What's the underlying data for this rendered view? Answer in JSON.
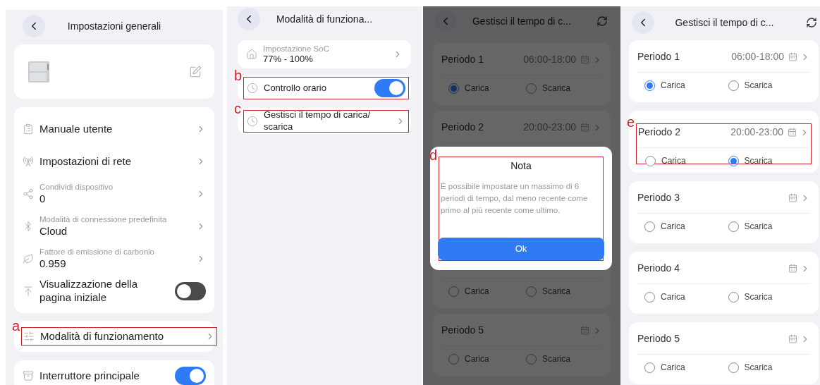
{
  "general_settings": {
    "title": "Impostazioni generali",
    "items": [
      {
        "kind": "link",
        "label": "Manuale utente"
      },
      {
        "kind": "link",
        "label": "Impostazioni di rete"
      },
      {
        "kind": "value",
        "caption": "Condividi dispositivo",
        "value": "0"
      },
      {
        "kind": "value",
        "caption": "Modalità di connessione predefinita",
        "value": "Cloud"
      },
      {
        "kind": "value",
        "caption": "Fattore di emissione di carbonio",
        "value": "0.959"
      },
      {
        "kind": "toggle",
        "label": "Visualizzazione della pagina iniziale",
        "on": false
      }
    ],
    "mode_row": {
      "label": "Modalità di funzionamento",
      "annotation": "a"
    },
    "main_switch": {
      "label": "Interruttore principale",
      "on": true
    }
  },
  "operating_mode": {
    "title": "Modalità di funziona...",
    "items": [
      {
        "kind": "value",
        "caption": "Impostazione SoC",
        "value": "77% - 100%"
      },
      {
        "kind": "toggle",
        "label": "Controllo orario",
        "on": true,
        "annotation": "b"
      },
      {
        "kind": "link",
        "label": "Gestisci il tempo di carica/ scarica",
        "annotation": "c"
      }
    ]
  },
  "schedule_with_note": {
    "title": "Gestisci il tempo di c...",
    "periods": [
      {
        "title": "Periodo 1",
        "time": "06:00-18:00",
        "options": [
          {
            "label": "Carica",
            "selected": true
          },
          {
            "label": "Scarica",
            "selected": false
          }
        ]
      },
      {
        "title": "Periodo 2",
        "time": "20:00-23:00"
      },
      {
        "options": [
          {
            "label": "Carica",
            "selected": false
          },
          {
            "label": "Scarica",
            "selected": false
          }
        ]
      },
      {
        "title": "Periodo 5",
        "options": [
          {
            "label": "Carica",
            "selected": false
          },
          {
            "label": "Scarica",
            "selected": false
          }
        ]
      }
    ],
    "dialog": {
      "title": "Nota",
      "message": "È possibile impostare un massimo di 6 periodi di tempo, dal meno recente come primo al più recente come ultimo.",
      "button": "Ok",
      "annotation": "d"
    }
  },
  "schedule": {
    "title": "Gestisci il tempo di c...",
    "periods": [
      {
        "title": "Periodo 1",
        "time": "06:00-18:00",
        "options": [
          {
            "label": "Carica",
            "selected": true
          },
          {
            "label": "Scarica",
            "selected": false
          }
        ]
      },
      {
        "title": "Periodo 2",
        "time": "20:00-23:00",
        "annotation": "e",
        "options": [
          {
            "label": "Carica",
            "selected": false
          },
          {
            "label": "Scarica",
            "selected": true
          }
        ]
      },
      {
        "title": "Periodo 3",
        "options": [
          {
            "label": "Carica",
            "selected": false
          },
          {
            "label": "Scarica",
            "selected": false
          }
        ]
      },
      {
        "title": "Periodo 4",
        "options": [
          {
            "label": "Carica",
            "selected": false
          },
          {
            "label": "Scarica",
            "selected": false
          }
        ]
      },
      {
        "title": "Periodo 5",
        "options": [
          {
            "label": "Carica",
            "selected": false
          },
          {
            "label": "Scarica",
            "selected": false
          }
        ]
      }
    ]
  }
}
